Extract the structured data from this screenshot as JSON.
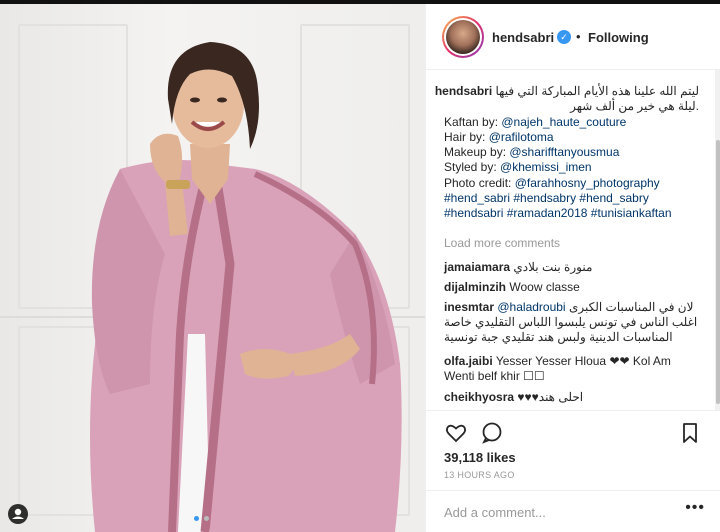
{
  "post": {
    "username": "hendsabri",
    "separator": "•",
    "follow_status": "Following",
    "caption": {
      "arabic_line1": "ليتم الله علينا هذه الأيام المباركة التي فيها",
      "arabic_line2": ".ليلة هي خير من ألف شهر",
      "kaftan_label": "Kaftan by: ",
      "kaftan_handle": "@najeh_haute_couture",
      "hair_label": "Hair by: ",
      "hair_handle": "@rafilotoma",
      "makeup_label": "Makeup by: ",
      "makeup_handle": "@sharifftanyousmua",
      "styled_label": "Styled by: ",
      "styled_handle": "@khemissi_imen",
      "photo_label": "Photo credit: ",
      "photo_handle": "@farahhosny_photography",
      "hashtags_line1": "#hend_sabri #hendsabry #hend_sabry",
      "hashtags_line2": "#hendsabri #ramadan2018 #tunisiankaftan"
    },
    "load_more": "Load more comments",
    "comments": [
      {
        "user": "jamaiamara",
        "text": "منورة بنت بلادي"
      },
      {
        "user": "dijalminzih",
        "text": "Woow classe"
      },
      {
        "user": "inesmtar",
        "mention": "@haladroubi",
        "text": "لان في المناسبات الكبرى",
        "line2": "اغلب الناس في تونس يلبسوا اللباس التقليدي خاصة",
        "line3": "المناسبات الدينية ولبس هند تقليدي جبة تونسية"
      },
      {
        "user": "olfa.jaibi",
        "text": "Yesser Yesser Hloua ❤❤ Kol Am",
        "line2": "Wenti belf khir ☐☐"
      },
      {
        "user": "cheikhyosra",
        "text": "♥♥♥احلى هند"
      }
    ],
    "likes": "39,118 likes",
    "time_ago": "13 HOURS AGO",
    "comment_placeholder": "Add a comment...",
    "more_options": "•••"
  },
  "colors": {
    "link": "#003569",
    "verified": "#3897f0",
    "kaftan": "#d9a2b8"
  },
  "icons": [
    "verified-badge-icon",
    "heart-icon",
    "comment-icon",
    "bookmark-icon",
    "user-tag-icon",
    "more-options-icon"
  ]
}
